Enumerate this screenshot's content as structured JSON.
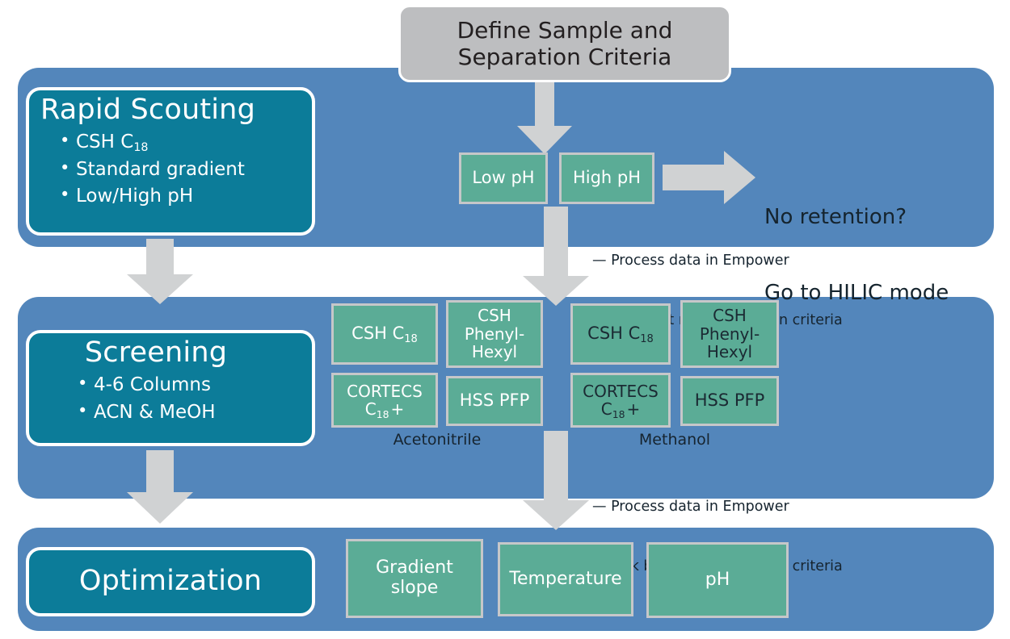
{
  "colors": {
    "panel_blue": "#5386BB",
    "stage_teal": "#0C7C99",
    "green_box": "#5BAC96",
    "gray_box": "#BDBEC0",
    "arrow_gray": "#D0D2D3",
    "text_dark": "#1B2A3A",
    "text_white": "#FFFFFF"
  },
  "top_box": {
    "line1": "Define Sample and",
    "line2": "Separation Criteria"
  },
  "stages": [
    {
      "id": "rapid-scouting",
      "title": "Rapid Scouting",
      "bullets": [
        "CSH C18",
        "Standard gradient",
        "Low/High pH"
      ]
    },
    {
      "id": "screening",
      "title": "Screening",
      "bullets": [
        "4-6 Columns",
        "ACN & MeOH"
      ]
    },
    {
      "id": "optimization",
      "title": "Optimization",
      "bullets": []
    }
  ],
  "scouting": {
    "ph_boxes": [
      {
        "label": "Low pH"
      },
      {
        "label": "High pH"
      }
    ],
    "hilic_note": {
      "line1": "No retention?",
      "line2": "Go to HILIC mode"
    },
    "notes": [
      "— Process data in Empower",
      "— Pick best result based on criteria"
    ]
  },
  "screening": {
    "groups": [
      {
        "solvent": "Acetonitrile",
        "text_style": "white",
        "columns": [
          {
            "lines": [
              "CSH C18"
            ]
          },
          {
            "lines": [
              "CSH",
              "Phenyl-",
              "Hexyl"
            ]
          },
          {
            "lines": [
              "CORTECS",
              "C18 +"
            ]
          },
          {
            "lines": [
              "HSS PFP"
            ]
          }
        ]
      },
      {
        "solvent": "Methanol",
        "text_style": "dark",
        "columns": [
          {
            "lines": [
              "CSH C18"
            ]
          },
          {
            "lines": [
              "CSH",
              "Phenyl-",
              "Hexyl"
            ]
          },
          {
            "lines": [
              "CORTECS",
              "C18 +"
            ]
          },
          {
            "lines": [
              "HSS PFP"
            ]
          }
        ]
      }
    ],
    "notes": [
      "— Process data in Empower",
      "— Pick best result based on criteria"
    ]
  },
  "optimization": {
    "factors": [
      {
        "lines": [
          "Gradient",
          "slope"
        ]
      },
      {
        "lines": [
          "Temperature"
        ]
      },
      {
        "lines": [
          "pH"
        ]
      }
    ]
  }
}
